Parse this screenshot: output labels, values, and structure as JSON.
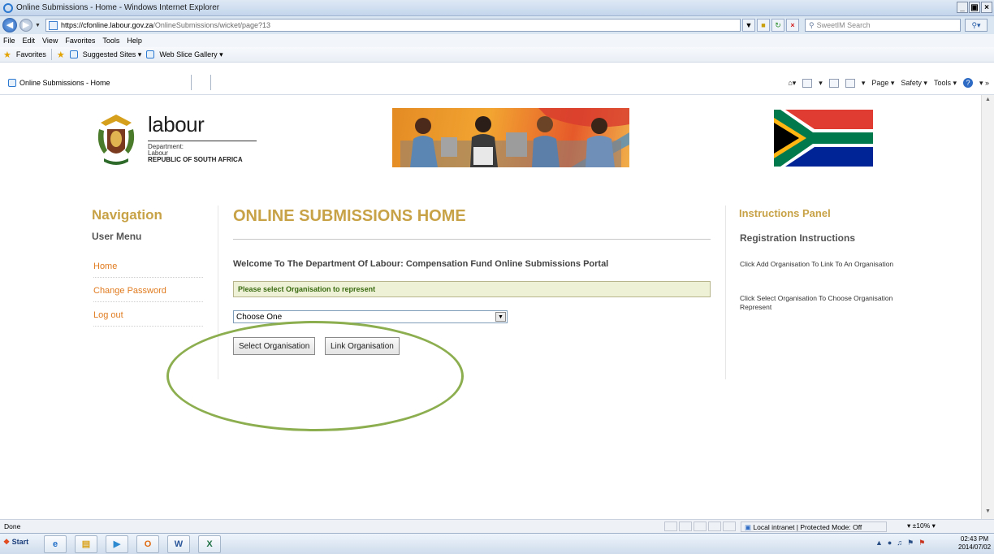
{
  "browser": {
    "window_title": "Online Submissions - Home - Windows Internet Explorer",
    "url_host": "https://cfonline.labour.gov.za",
    "url_path": "/OnlineSubmissions/wicket/page?13",
    "search_placeholder": "SweetIM Search",
    "menu": [
      "File",
      "Edit",
      "View",
      "Favorites",
      "Tools",
      "Help"
    ],
    "favorites_label": "Favorites",
    "favorites_items": [
      "Suggested Sites ▾",
      "Web Slice Gallery ▾"
    ],
    "tab_title": "Online Submissions - Home",
    "commands": [
      "Page ▾",
      "Safety ▾",
      "Tools ▾"
    ]
  },
  "header": {
    "brand": "labour",
    "dept_line1": "Department:",
    "dept_line2": "Labour",
    "dept_line3": "REPUBLIC OF SOUTH AFRICA"
  },
  "navigation": {
    "title": "Navigation",
    "user_menu": "User Menu",
    "links": [
      "Home",
      "Change Password",
      "Log out"
    ]
  },
  "main": {
    "title": "ONLINE SUBMISSIONS HOME",
    "welcome": "Welcome To The Department Of Labour: Compensation Fund Online Submissions Portal",
    "notice": "Please select Organisation to represent",
    "select_value": "Choose One",
    "select_button": "Select Organisation",
    "link_button": "Link Organisation"
  },
  "instructions": {
    "title": "Instructions Panel",
    "subtitle": "Registration Instructions",
    "items": [
      "Click Add Organisation To Link To An Organisation",
      "Click Select Organisation To Choose Organisation Represent"
    ]
  },
  "statusbar": {
    "status": "Done",
    "zone": "Local intranet | Protected Mode: Off",
    "zoom": "▾  ±10%  ▾"
  },
  "taskbar": {
    "start": "Start",
    "time": "02:43 PM",
    "date": "2014/07/02"
  },
  "colors": {
    "accent_gold": "#c8a246",
    "link_orange": "#e07b1f",
    "annotation_green": "#8cae4f"
  }
}
